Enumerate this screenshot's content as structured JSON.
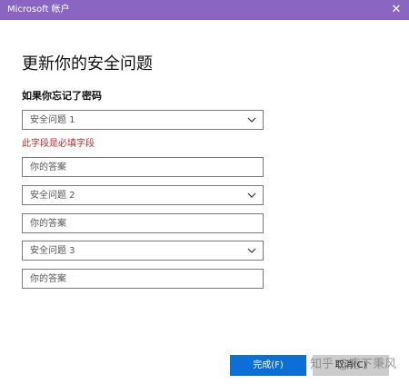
{
  "window": {
    "title": "Microsoft 帐户",
    "close_glyph": "✕"
  },
  "page": {
    "heading": "更新你的安全问题",
    "subheading": "如果你忘记了密码",
    "error_message": "此字段是必填字段"
  },
  "form": {
    "question1": {
      "value": "安全问题 1"
    },
    "answer1": {
      "placeholder": "你的答案"
    },
    "question2": {
      "value": "安全问题 2"
    },
    "answer2": {
      "placeholder": "你的答案"
    },
    "question3": {
      "value": "安全问题 3"
    },
    "answer3": {
      "placeholder": "你的答案"
    }
  },
  "buttons": {
    "done": "完成(F)",
    "cancel": "取消(C)"
  },
  "watermark": "知乎 @南下秉风",
  "colors": {
    "titlebar": "#8a66c2",
    "primary_button": "#0b6fd6",
    "error": "#c1272d"
  },
  "icons": {
    "close": "close-icon",
    "dropdown": "chevron-down-icon"
  }
}
